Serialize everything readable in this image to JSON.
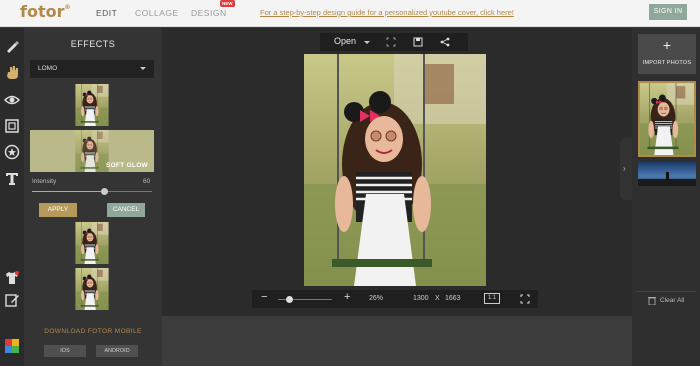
{
  "header": {
    "logo": "fotor",
    "logo_mark": "®",
    "nav": [
      "EDIT",
      "COLLAGE",
      "DESIGN"
    ],
    "new_badge": "NEW",
    "guide_link": "For a step-by-step design guide for a personalized youtube cover, click here!",
    "signin": "SIGN IN"
  },
  "rail": {
    "icons": [
      "brush-icon",
      "hand-icon",
      "eye-icon",
      "frame-icon",
      "sticker-icon",
      "text-icon",
      "tshirt-icon",
      "edit-icon",
      "palette-icon"
    ]
  },
  "effects": {
    "title": "EFFECTS",
    "selected": "LOMO",
    "thumbs": [
      {
        "label": ""
      },
      {
        "label": "SOFT GLOW"
      },
      {
        "label": ""
      },
      {
        "label": ""
      }
    ],
    "intensity_label": "Intensity",
    "intensity_value": "60",
    "intensity_fraction": 0.6,
    "apply": "APPLY",
    "cancel": "CANCEL",
    "download_title": "DOWNLOAD FOTOR MOBILE",
    "ios": "IOS",
    "android": "ANDROID"
  },
  "canvas": {
    "open_label": "Open",
    "zoom_minus": "−",
    "zoom_plus": "+",
    "zoom": "26%",
    "width": "1300",
    "x_sep": "X",
    "height": "1663",
    "one_to_one": "1:1"
  },
  "right_panel": {
    "import": "IMPORT PHOTOS",
    "import_plus": "+",
    "clear_all": "Clear All",
    "collapse_glyph": "›"
  },
  "colors": {
    "accent": "#b08a4a",
    "sage": "#8fa89a",
    "badge": "#e23a3a"
  }
}
